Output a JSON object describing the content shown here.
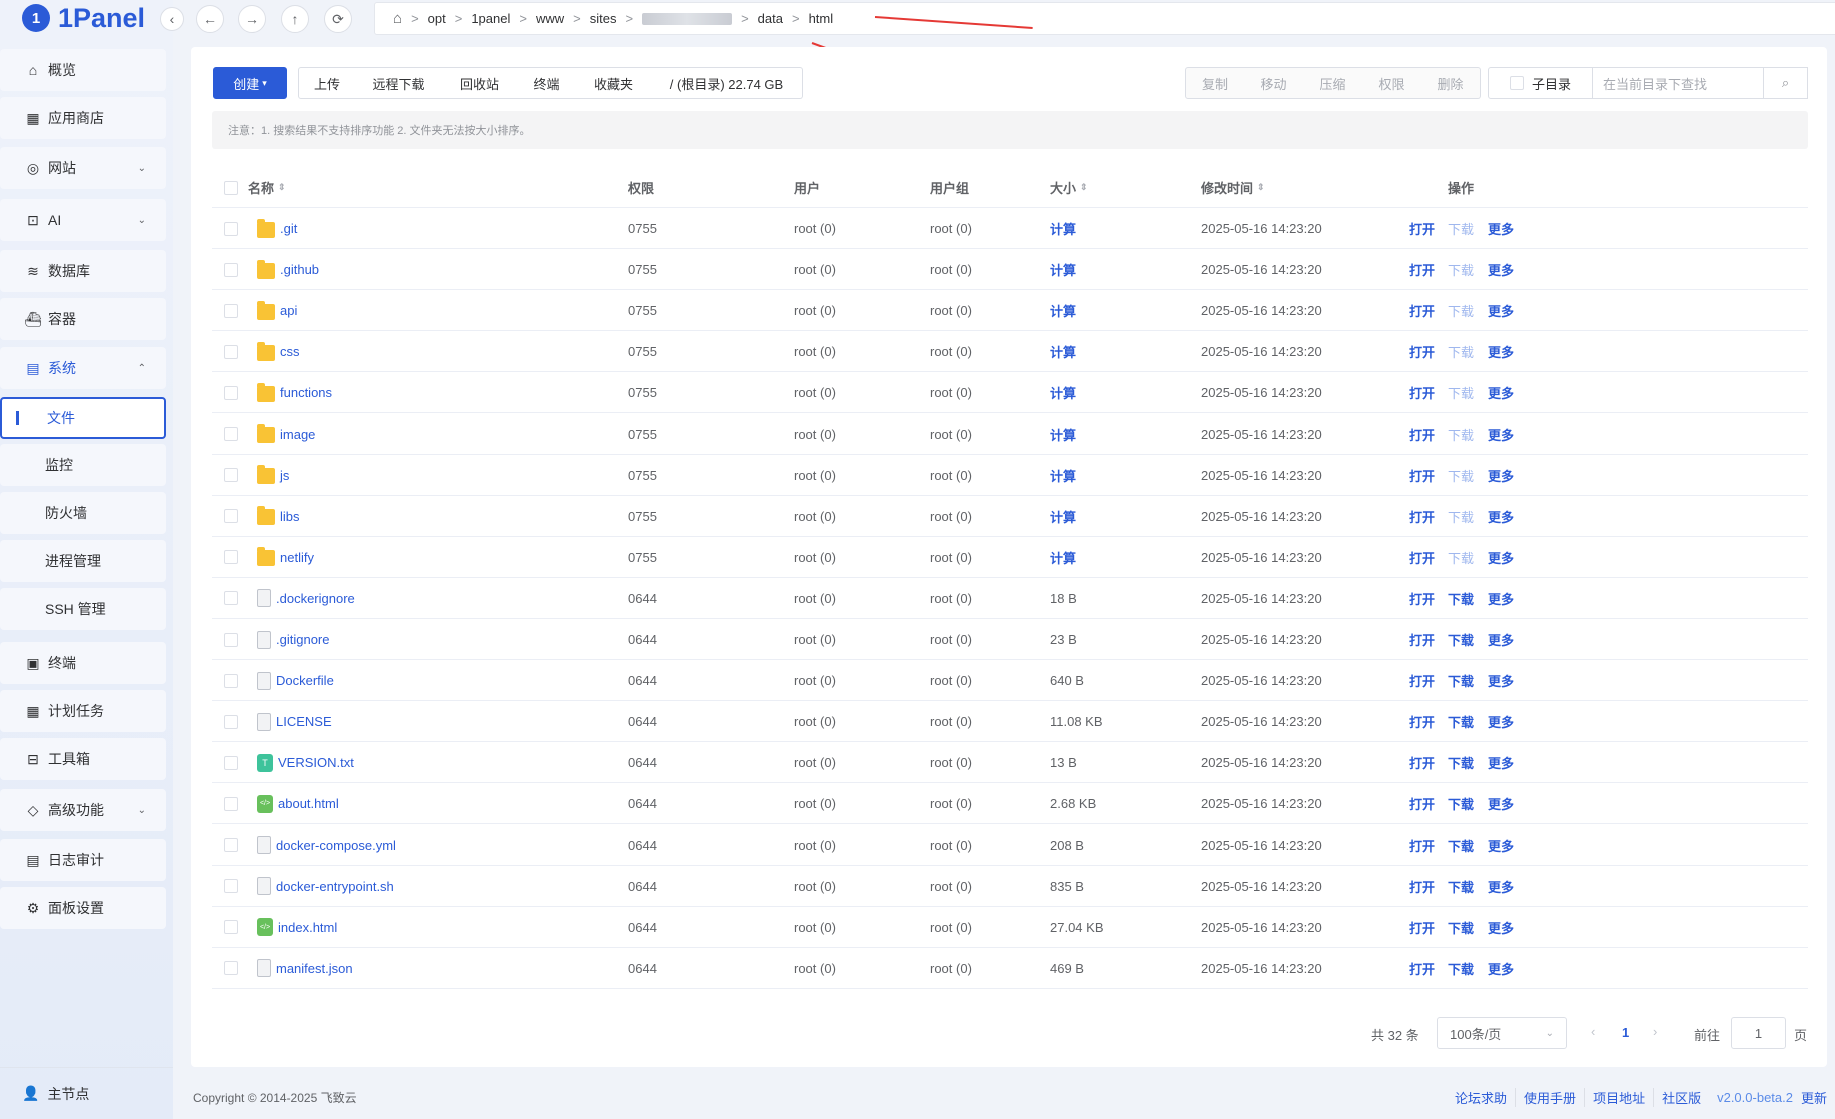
{
  "brand": {
    "name": "1Panel"
  },
  "nav": {
    "items": [
      {
        "label": "概览",
        "icon": "home-icon"
      },
      {
        "label": "应用商店",
        "icon": "grid-icon"
      },
      {
        "label": "网站",
        "icon": "globe-icon"
      },
      {
        "label": "AI",
        "icon": "robot-icon"
      },
      {
        "label": "数据库",
        "icon": "layers-icon"
      },
      {
        "label": "容器",
        "icon": "docker-icon"
      },
      {
        "label": "系统",
        "icon": "server-icon"
      }
    ],
    "sub_items": [
      "文件",
      "监控",
      "防火墙",
      "进程管理",
      "SSH 管理"
    ],
    "items2": [
      {
        "label": "终端",
        "icon": "terminal-icon"
      },
      {
        "label": "计划任务",
        "icon": "calendar-icon"
      },
      {
        "label": "工具箱",
        "icon": "toolbox-icon"
      },
      {
        "label": "高级功能",
        "icon": "diamond-icon"
      },
      {
        "label": "日志审计",
        "icon": "log-icon"
      },
      {
        "label": "面板设置",
        "icon": "gear-icon"
      }
    ],
    "node_label": "主节点"
  },
  "path": {
    "segments": [
      "opt",
      "1panel",
      "www",
      "sites"
    ],
    "tail": [
      "data",
      "html"
    ]
  },
  "toolbar": {
    "create": "创建",
    "upload": "上传",
    "remote_download": "远程下载",
    "recycle": "回收站",
    "terminal": "终端",
    "favorites": "收藏夹",
    "disk": "/ (根目录) 22.74 GB",
    "copy": "复制",
    "move": "移动",
    "compress": "压缩",
    "perm": "权限",
    "delete": "删除",
    "subdir": "子目录",
    "search_placeholder": "在当前目录下查找"
  },
  "notice": "注意：1. 搜索结果不支持排序功能 2. 文件夹无法按大小排序。",
  "table": {
    "headers": {
      "name": "名称",
      "perm": "权限",
      "user": "用户",
      "group": "用户组",
      "size": "大小",
      "mtime": "修改时间",
      "ops": "操作"
    },
    "op_labels": {
      "open": "打开",
      "download": "下载",
      "more": "更多"
    },
    "rows": [
      {
        "name": ".git",
        "type": "dir",
        "perm": "0755",
        "user": "root (0)",
        "group": "root (0)",
        "size": "计算",
        "mtime": "2025-05-16 14:23:20"
      },
      {
        "name": ".github",
        "type": "dir",
        "perm": "0755",
        "user": "root (0)",
        "group": "root (0)",
        "size": "计算",
        "mtime": "2025-05-16 14:23:20"
      },
      {
        "name": "api",
        "type": "dir",
        "perm": "0755",
        "user": "root (0)",
        "group": "root (0)",
        "size": "计算",
        "mtime": "2025-05-16 14:23:20"
      },
      {
        "name": "css",
        "type": "dir",
        "perm": "0755",
        "user": "root (0)",
        "group": "root (0)",
        "size": "计算",
        "mtime": "2025-05-16 14:23:20"
      },
      {
        "name": "functions",
        "type": "dir",
        "perm": "0755",
        "user": "root (0)",
        "group": "root (0)",
        "size": "计算",
        "mtime": "2025-05-16 14:23:20"
      },
      {
        "name": "image",
        "type": "dir",
        "perm": "0755",
        "user": "root (0)",
        "group": "root (0)",
        "size": "计算",
        "mtime": "2025-05-16 14:23:20"
      },
      {
        "name": "js",
        "type": "dir",
        "perm": "0755",
        "user": "root (0)",
        "group": "root (0)",
        "size": "计算",
        "mtime": "2025-05-16 14:23:20"
      },
      {
        "name": "libs",
        "type": "dir",
        "perm": "0755",
        "user": "root (0)",
        "group": "root (0)",
        "size": "计算",
        "mtime": "2025-05-16 14:23:20"
      },
      {
        "name": "netlify",
        "type": "dir",
        "perm": "0755",
        "user": "root (0)",
        "group": "root (0)",
        "size": "计算",
        "mtime": "2025-05-16 14:23:20"
      },
      {
        "name": ".dockerignore",
        "type": "file",
        "perm": "0644",
        "user": "root (0)",
        "group": "root (0)",
        "size": "18 B",
        "mtime": "2025-05-16 14:23:20"
      },
      {
        "name": ".gitignore",
        "type": "file",
        "perm": "0644",
        "user": "root (0)",
        "group": "root (0)",
        "size": "23 B",
        "mtime": "2025-05-16 14:23:20"
      },
      {
        "name": "Dockerfile",
        "type": "file",
        "perm": "0644",
        "user": "root (0)",
        "group": "root (0)",
        "size": "640 B",
        "mtime": "2025-05-16 14:23:20"
      },
      {
        "name": "LICENSE",
        "type": "file",
        "perm": "0644",
        "user": "root (0)",
        "group": "root (0)",
        "size": "11.08 KB",
        "mtime": "2025-05-16 14:23:20"
      },
      {
        "name": "VERSION.txt",
        "type": "txt",
        "perm": "0644",
        "user": "root (0)",
        "group": "root (0)",
        "size": "13 B",
        "mtime": "2025-05-16 14:23:20"
      },
      {
        "name": "about.html",
        "type": "html",
        "perm": "0644",
        "user": "root (0)",
        "group": "root (0)",
        "size": "2.68 KB",
        "mtime": "2025-05-16 14:23:20"
      },
      {
        "name": "docker-compose.yml",
        "type": "file",
        "perm": "0644",
        "user": "root (0)",
        "group": "root (0)",
        "size": "208 B",
        "mtime": "2025-05-16 14:23:20"
      },
      {
        "name": "docker-entrypoint.sh",
        "type": "file",
        "perm": "0644",
        "user": "root (0)",
        "group": "root (0)",
        "size": "835 B",
        "mtime": "2025-05-16 14:23:20"
      },
      {
        "name": "index.html",
        "type": "html",
        "perm": "0644",
        "user": "root (0)",
        "group": "root (0)",
        "size": "27.04 KB",
        "mtime": "2025-05-16 14:23:20"
      },
      {
        "name": "manifest.json",
        "type": "file",
        "perm": "0644",
        "user": "root (0)",
        "group": "root (0)",
        "size": "469 B",
        "mtime": "2025-05-16 14:23:20"
      }
    ]
  },
  "pager": {
    "total": "共 32 条",
    "page_size": "100条/页",
    "current": "1",
    "goto_label": "前往",
    "goto_value": "1",
    "page_suffix": "页"
  },
  "footer": {
    "copyright": "Copyright © 2014-2025 飞致云",
    "links": [
      "论坛求助",
      "使用手册",
      "项目地址",
      "社区版"
    ],
    "version": "v2.0.0-beta.2",
    "update": "更新"
  },
  "colors": {
    "primary": "#2b5bd7",
    "annotation": "#e53935"
  }
}
